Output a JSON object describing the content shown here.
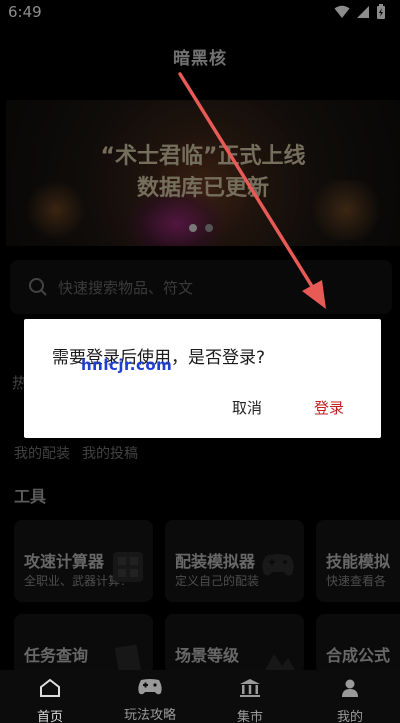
{
  "status_bar": {
    "time": "6:49",
    "icons": [
      "wifi-icon",
      "signal-icon",
      "battery-charging-icon"
    ]
  },
  "app": {
    "title": "暗黑核"
  },
  "banner": {
    "line1": "“术士君临”正式上线",
    "line2": "数据库已更新",
    "page_count": 2,
    "active_index": 0
  },
  "search": {
    "placeholder": "快速搜索物品、符文",
    "icon": "search-icon"
  },
  "hot": {
    "label": "热"
  },
  "links": {
    "my_builds": "我的配装",
    "my_posts": "我的投稿"
  },
  "tools": {
    "section_title": "工具",
    "cards": [
      {
        "title": "攻速计算器",
        "subtitle": "全职业、武器计算！",
        "icon": "calculator-icon"
      },
      {
        "title": "配装模拟器",
        "subtitle": "定义自己的配装",
        "icon": "gamepad-icon"
      },
      {
        "title": "技能模拟",
        "subtitle": "快速查看各",
        "icon": "skill-icon"
      },
      {
        "title": "任务查询",
        "subtitle": "",
        "icon": "quest-icon"
      },
      {
        "title": "场景等级",
        "subtitle": "",
        "icon": "scene-icon"
      },
      {
        "title": "合成公式",
        "subtitle": "",
        "icon": "formula-icon"
      }
    ]
  },
  "dialog": {
    "message": "需要登录后使用，是否登录?",
    "cancel_label": "取消",
    "login_label": "登录",
    "watermark": "hnlcjr.com"
  },
  "bottom_nav": {
    "items": [
      {
        "label": "首页",
        "icon": "home-icon",
        "active": true
      },
      {
        "label": "玩法攻略",
        "icon": "gamepad-icon",
        "active": false
      },
      {
        "label": "集市",
        "icon": "market-icon",
        "active": false
      },
      {
        "label": "我的",
        "icon": "user-icon",
        "active": false
      }
    ]
  },
  "colors": {
    "accent_red": "#c41f1f",
    "annotation_arrow": "#e85a55",
    "banner_text": "#d8c9a8",
    "watermark": "#1e3fd2"
  }
}
